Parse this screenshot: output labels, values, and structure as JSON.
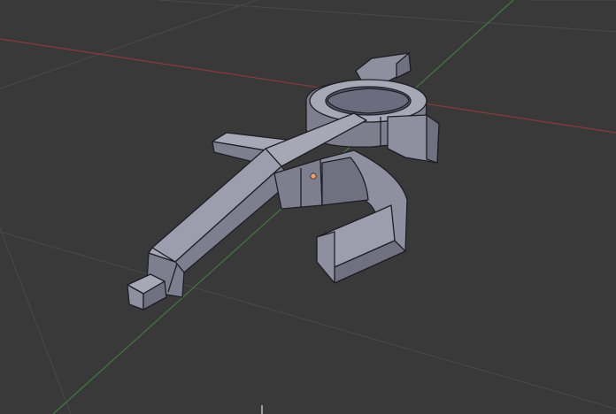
{
  "viewport": {
    "background": "#393939",
    "grid_color": "#4a4a4a",
    "x_axis_color": "#8a3b3b",
    "y_axis_color": "#3f7a3f",
    "object_color": "#8e90a0",
    "object_light": "#a6a8b6",
    "object_dark": "#6f7180",
    "edge_color": "#1e1e24",
    "origin_color": "#f0a060"
  },
  "scene": {
    "object_kind": "clamp-mesh",
    "icons": [
      "3d-cursor-icon",
      "object-origin-icon"
    ]
  }
}
